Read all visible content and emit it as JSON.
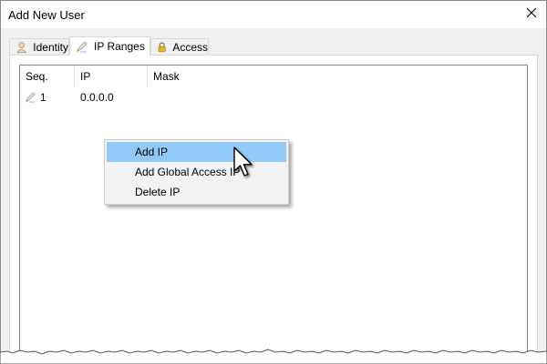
{
  "window": {
    "title": "Add New User"
  },
  "tabs": [
    {
      "label": "Identity",
      "icon": "user-icon",
      "active": false
    },
    {
      "label": "IP Ranges",
      "icon": "pen-icon",
      "active": true
    },
    {
      "label": "Access",
      "icon": "lock-icon",
      "active": false
    }
  ],
  "list": {
    "columns": [
      "Seq.",
      "IP",
      "Mask"
    ],
    "rows": [
      {
        "seq": "1",
        "ip": "0.0.0.0",
        "mask": ""
      }
    ]
  },
  "context_menu": {
    "items": [
      {
        "label": "Add IP",
        "highlighted": true
      },
      {
        "label": "Add Global Access IP",
        "highlighted": false
      },
      {
        "label": "Delete IP",
        "highlighted": false
      }
    ]
  },
  "colors": {
    "menu_highlight": "#91c9f7",
    "window_bg": "#f0f0f0",
    "border": "#828790"
  }
}
